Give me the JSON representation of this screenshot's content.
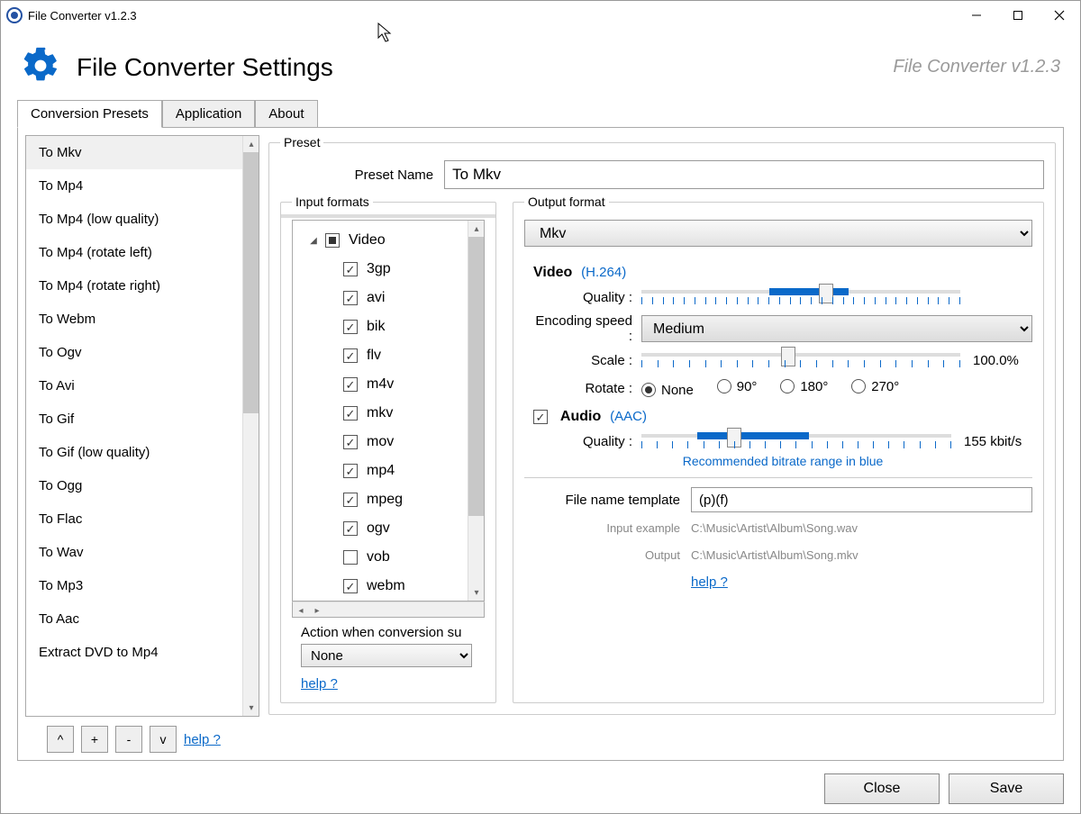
{
  "window": {
    "title": "File Converter v1.2.3"
  },
  "header": {
    "title": "File Converter Settings",
    "version": "File Converter v1.2.3"
  },
  "tabs": {
    "t0": "Conversion Presets",
    "t1": "Application",
    "t2": "About"
  },
  "presets": {
    "p0": "To Mkv",
    "p1": "To Mp4",
    "p2": "To Mp4 (low quality)",
    "p3": "To Mp4 (rotate left)",
    "p4": "To Mp4 (rotate right)",
    "p5": "To Webm",
    "p6": "To Ogv",
    "p7": "To Avi",
    "p8": "To Gif",
    "p9": "To Gif (low quality)",
    "p10": "To Ogg",
    "p11": "To Flac",
    "p12": "To Wav",
    "p13": "To Mp3",
    "p14": "To Aac",
    "p15": "Extract DVD to Mp4"
  },
  "leftButtons": {
    "up": "^",
    "add": "+",
    "remove": "-",
    "down": "v",
    "help": "help ?"
  },
  "preset": {
    "legend": "Preset",
    "nameLabel": "Preset Name",
    "nameValue": "To Mkv"
  },
  "inputFormats": {
    "legend": "Input formats",
    "group": "Video",
    "f0": "3gp",
    "f1": "avi",
    "f2": "bik",
    "f3": "flv",
    "f4": "m4v",
    "f5": "mkv",
    "f6": "mov",
    "f7": "mp4",
    "f8": "mpeg",
    "f9": "ogv",
    "f10": "vob",
    "f11": "webm",
    "f10checked": false,
    "actionLabel": "Action when conversion su",
    "actionValue": "None",
    "help": "help ?"
  },
  "output": {
    "legend": "Output format",
    "formatValue": "Mkv",
    "video": {
      "title": "Video",
      "codec": "(H.264)",
      "qualityLabel": "Quality :",
      "encLabel": "Encoding speed :",
      "encValue": "Medium",
      "scaleLabel": "Scale :",
      "scaleValue": "100.0%",
      "rotateLabel": "Rotate :",
      "rot0": "None",
      "rot1": "90°",
      "rot2": "180°",
      "rot3": "270°"
    },
    "audio": {
      "title": "Audio",
      "codec": "(AAC)",
      "qualityLabel": "Quality :",
      "qualityValue": "155 kbit/s",
      "hint": "Recommended bitrate range in blue"
    },
    "template": {
      "label": "File name template",
      "value": "(p)(f)",
      "inLabel": "Input example",
      "inVal": "C:\\Music\\Artist\\Album\\Song.wav",
      "outLabel": "Output",
      "outVal": "C:\\Music\\Artist\\Album\\Song.mkv",
      "help": "help ?"
    }
  },
  "footer": {
    "close": "Close",
    "save": "Save"
  }
}
